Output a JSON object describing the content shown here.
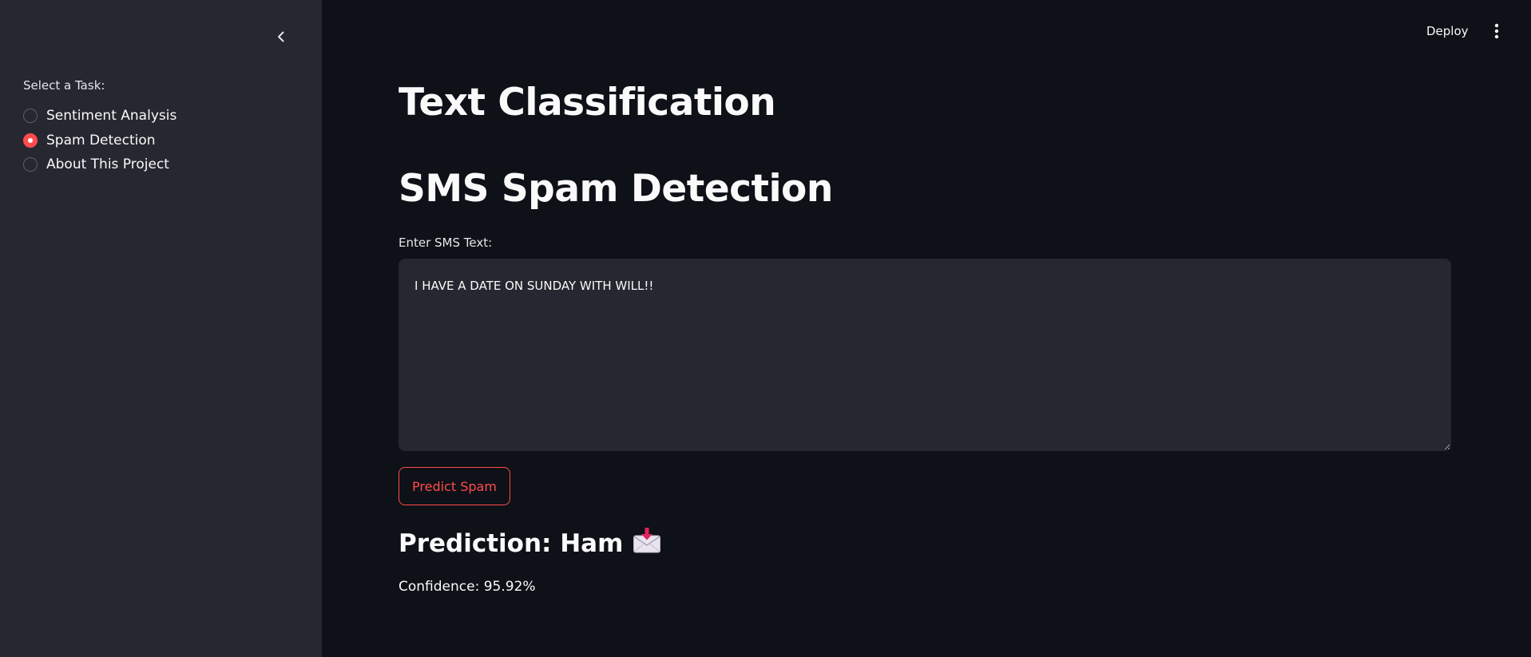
{
  "sidebar": {
    "collapse_icon": "chevron-left-icon",
    "task_label": "Select a Task:",
    "options": [
      {
        "label": "Sentiment Analysis",
        "selected": false
      },
      {
        "label": "Spam Detection",
        "selected": true
      },
      {
        "label": "About This Project",
        "selected": false
      }
    ]
  },
  "header": {
    "deploy_label": "Deploy",
    "menu_icon": "vertical-ellipsis-icon"
  },
  "main": {
    "title": "Text Classification",
    "section_title": "SMS Spam Detection",
    "input_label": "Enter SMS Text:",
    "input_value": "I HAVE A DATE ON SUNDAY WITH WILL!!",
    "predict_button": "Predict Spam",
    "prediction_text": "Prediction: Ham",
    "prediction_icon": "incoming-envelope-icon",
    "confidence_text": "Confidence: 95.92%"
  },
  "colors": {
    "accent": "#ff4b4b",
    "background": "#0e1117",
    "sidebar_background": "#262730",
    "input_background": "#262730",
    "text": "#fafafa"
  }
}
